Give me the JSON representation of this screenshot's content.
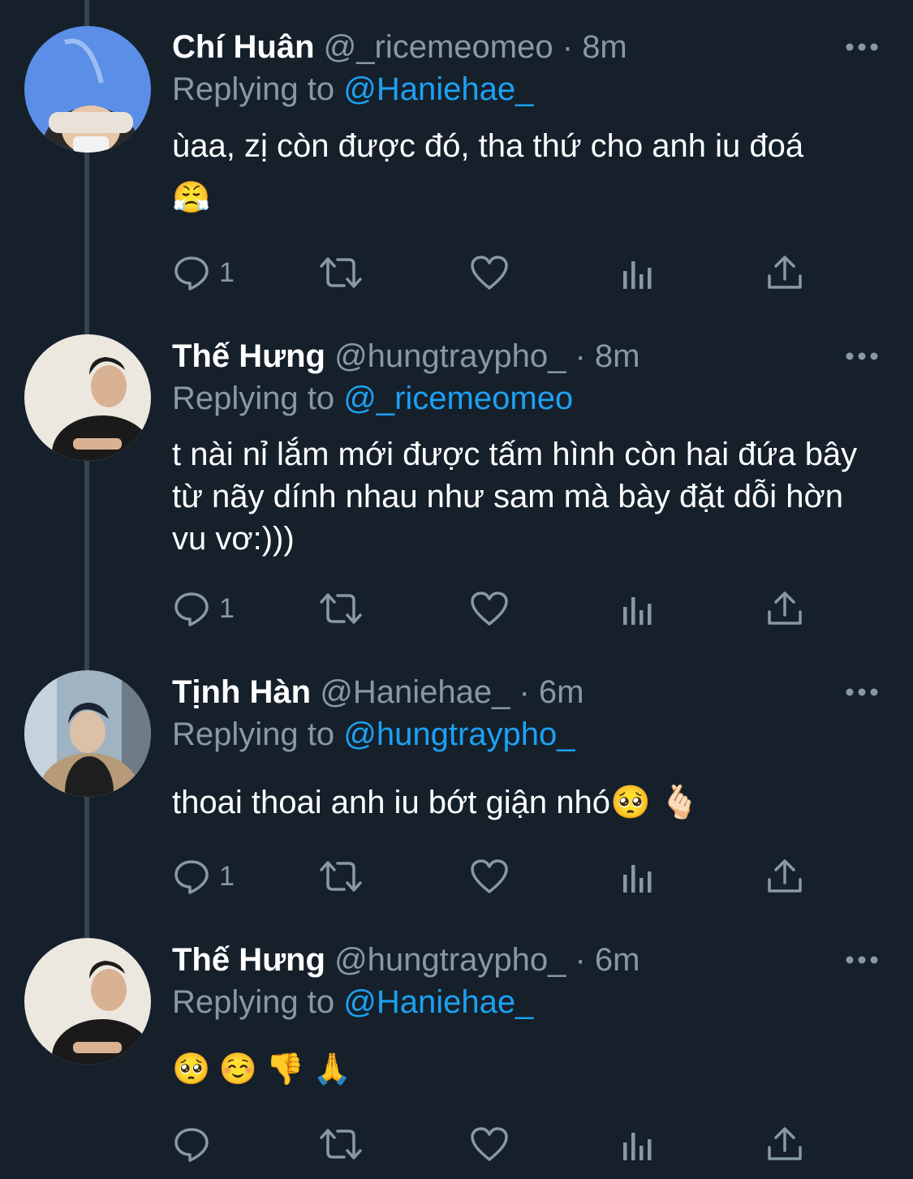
{
  "colors": {
    "background": "#15202b",
    "text": "#ffffff",
    "secondary_text": "#8899a6",
    "mention": "#1da1f2",
    "icon": "#8899a6",
    "thread_line": "#38444d"
  },
  "tweets": [
    {
      "name": "Chí Huân",
      "handle": "@_ricemeomeo",
      "dot": "·",
      "time": "8m",
      "replying_prefix": "Replying to",
      "replying_to": "@Haniehae_",
      "text": "ùaa, zị còn được đó, tha thứ cho anh iu đoá",
      "emojis": [
        "😤"
      ],
      "reply_count": "1",
      "avatar": "sky-headband-avatar"
    },
    {
      "name": "Thế Hưng",
      "handle": "@hungtraypho_",
      "dot": "·",
      "time": "8m",
      "replying_prefix": "Replying to",
      "replying_to": "@_ricemeomeo",
      "text": "t nài nỉ lắm mới được tấm hình còn hai đứa bây từ nãy dính nhau như sam mà bày đặt dỗi hờn vu vơ:)))",
      "emojis": [],
      "reply_count": "1",
      "avatar": "black-shirt-avatar"
    },
    {
      "name": "Tịnh Hàn",
      "handle": "@Haniehae_",
      "dot": "·",
      "time": "6m",
      "replying_prefix": "Replying to",
      "replying_to": "@hungtraypho_",
      "text": "thoai thoai anh iu bớt giận nhó",
      "emojis": [
        "🥺",
        "🫰🏻"
      ],
      "reply_count": "1",
      "avatar": "window-jacket-avatar"
    },
    {
      "name": "Thế Hưng",
      "handle": "@hungtraypho_",
      "dot": "·",
      "time": "6m",
      "replying_prefix": "Replying to",
      "replying_to": "@Haniehae_",
      "text": "",
      "emojis": [
        "🥺",
        "☺️",
        "👎",
        "🙏"
      ],
      "reply_count": "",
      "avatar": "black-shirt-avatar"
    }
  ],
  "icons": {
    "reply": "reply-icon",
    "retweet": "retweet-icon",
    "like": "heart-icon",
    "analytics": "analytics-icon",
    "share": "share-icon",
    "more": "more-icon"
  }
}
